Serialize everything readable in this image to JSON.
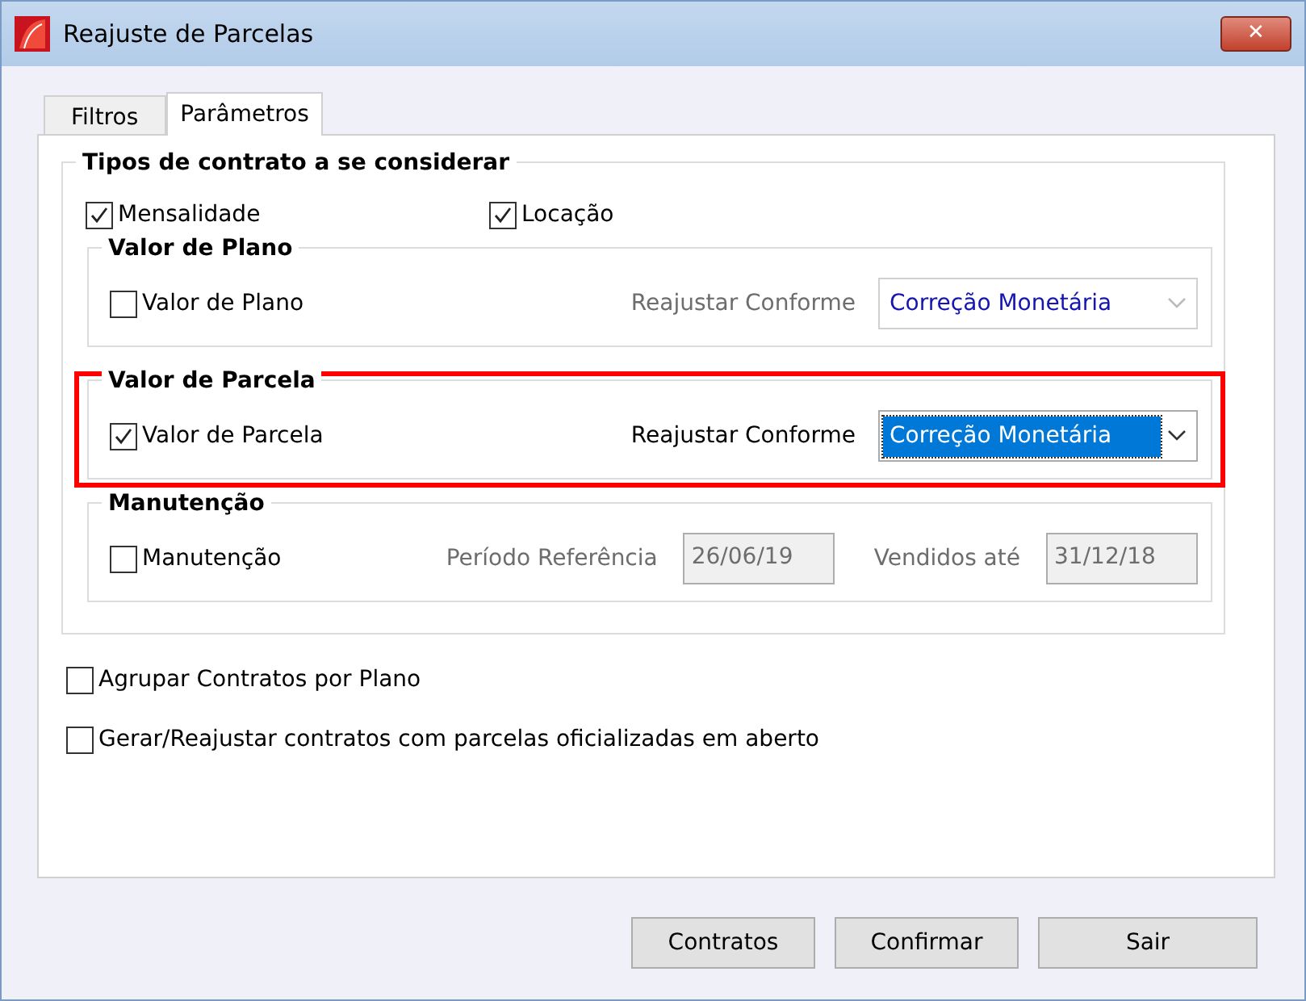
{
  "window": {
    "title": "Reajuste de Parcelas",
    "close": "✕"
  },
  "tabs": [
    {
      "label": "Filtros",
      "selected": false
    },
    {
      "label": "Parâmetros",
      "selected": true
    }
  ],
  "contract_types": {
    "title": "Tipos de contrato a se considerar",
    "checkboxes": [
      {
        "label": "Mensalidade",
        "checked": true
      },
      {
        "label": "Locação",
        "checked": true
      }
    ],
    "groups": [
      {
        "kind": "combo",
        "title": "Valor de Plano",
        "highlighted": false,
        "checkbox": {
          "label": "Valor de Plano",
          "checked": false
        },
        "combo_label": "Reajustar Conforme",
        "combo": {
          "value": "Correção Monetária",
          "disabled": true,
          "focused": false
        }
      },
      {
        "kind": "combo",
        "title": "Valor de Parcela",
        "highlighted": true,
        "checkbox": {
          "label": "Valor de Parcela",
          "checked": true
        },
        "combo_label": "Reajustar Conforme",
        "combo": {
          "value": "Correção Monetária",
          "disabled": false,
          "focused": true
        }
      },
      {
        "kind": "dates",
        "title": "Manutenção",
        "highlighted": false,
        "checkbox": {
          "label": "Manutenção",
          "checked": false
        },
        "fields": [
          {
            "label": "Período Referência",
            "value": "26/06/19",
            "disabled": true
          },
          {
            "label": "Vendidos até",
            "value": "31/12/18",
            "disabled": true
          }
        ]
      }
    ]
  },
  "options": [
    {
      "label": "Agrupar Contratos por Plano",
      "checked": false
    },
    {
      "label": "Gerar/Reajustar contratos com parcelas oficializadas em aberto",
      "checked": false
    }
  ],
  "buttons": [
    "Contratos",
    "Confirmar",
    "Sair"
  ]
}
